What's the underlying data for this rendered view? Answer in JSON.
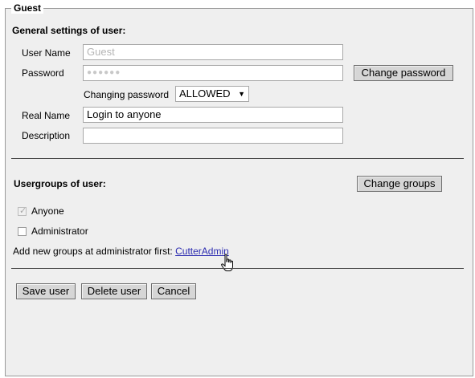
{
  "panel": {
    "title": "Guest"
  },
  "general": {
    "heading": "General settings of user:",
    "username_label": "User Name",
    "username_value": "Guest",
    "password_label": "Password",
    "password_value": "●●●●●●",
    "change_password_button": "Change password",
    "changing_password_label": "Changing password",
    "changing_password_value": "ALLOWED",
    "realname_label": "Real Name",
    "realname_value": "Login to anyone",
    "description_label": "Description",
    "description_value": ""
  },
  "groups": {
    "heading": "Usergroups of user:",
    "change_groups_button": "Change groups",
    "items": [
      {
        "label": "Anyone",
        "checked": true,
        "disabled": true
      },
      {
        "label": "Administrator",
        "checked": false,
        "disabled": false
      }
    ],
    "add_text": "Add new groups at administrator first:",
    "add_link": "CutterAdmin"
  },
  "actions": {
    "save": "Save user",
    "delete": "Delete user",
    "cancel": "Cancel"
  },
  "icons": {
    "select_arrow": "chevron-down-icon",
    "checkmark": "checkmark-icon",
    "cursor": "hand-pointer-icon"
  }
}
